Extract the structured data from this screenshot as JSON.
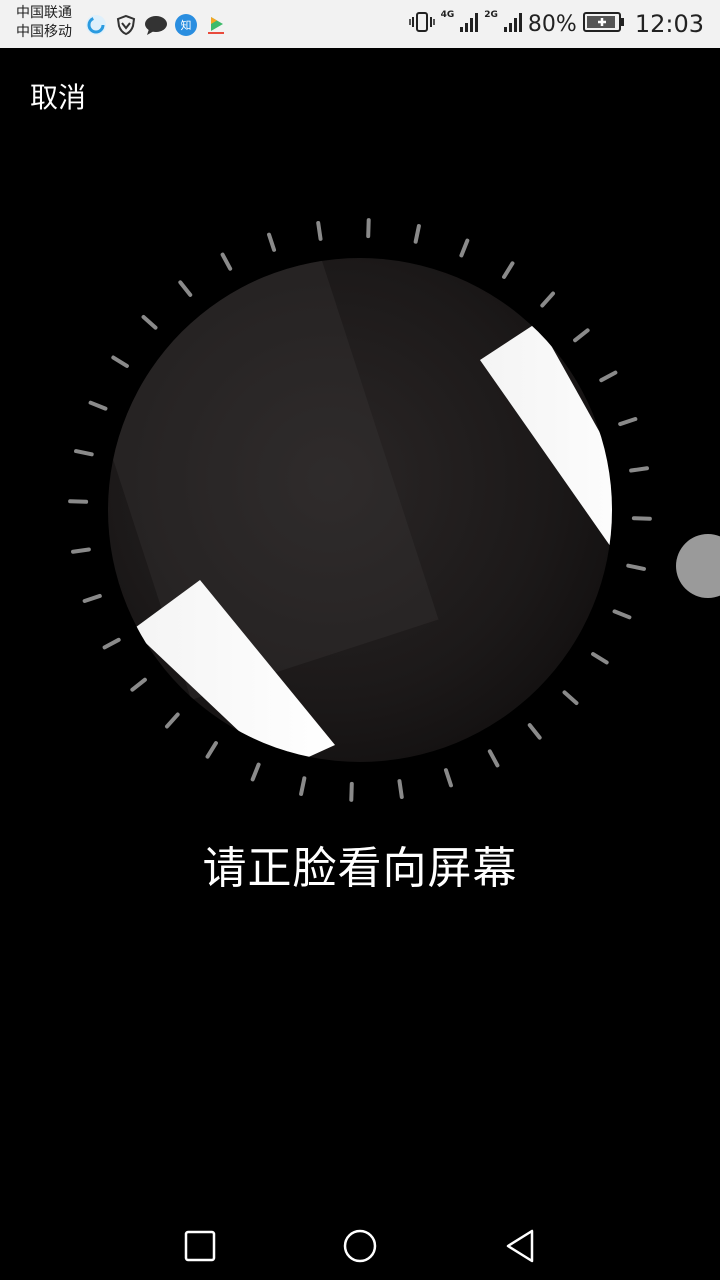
{
  "status_bar": {
    "carrier_1": "中国联通",
    "carrier_2": "中国移动",
    "notification_icons": [
      "circle-app-icon",
      "shield-icon",
      "chat-bubble-icon",
      "zhihu-icon",
      "video-app-icon"
    ],
    "network_1": "4G",
    "network_2": "2G",
    "battery_percent": "80%",
    "time": "12:03"
  },
  "header": {
    "cancel_label": "取消"
  },
  "face_capture": {
    "prompt": "请正脸看向屏幕",
    "tick_color": "#8a8a8a"
  },
  "nav_bar": {
    "buttons": [
      "recents-square-icon",
      "home-circle-icon",
      "back-triangle-icon"
    ]
  }
}
